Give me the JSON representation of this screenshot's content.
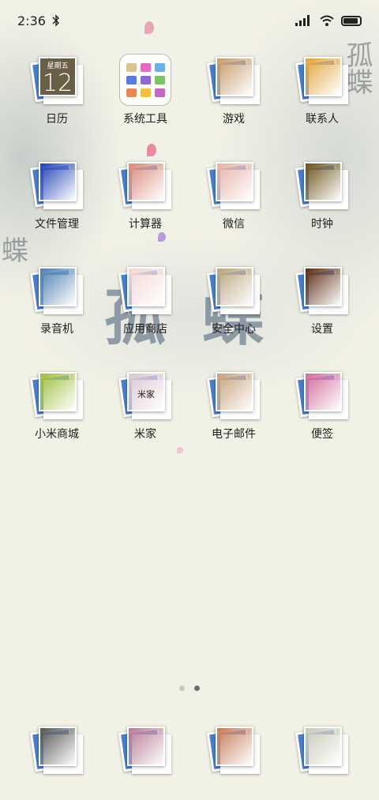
{
  "status_bar": {
    "time": "2:36",
    "battery_level": 0.9
  },
  "wallpaper": {
    "title": "孤蝶",
    "corner_text": "孤蝶",
    "left_text": "蝶"
  },
  "calendar": {
    "weekday": "星期五",
    "day": "12"
  },
  "apps": [
    {
      "label": "日历",
      "icon": "calendar-icon",
      "color": "#6b5e46"
    },
    {
      "label": "系统工具",
      "icon": "folder-icon",
      "color": "#ffffff"
    },
    {
      "label": "游戏",
      "icon": "game-icon",
      "color": "#c69a6a"
    },
    {
      "label": "联系人",
      "icon": "contacts-icon",
      "color": "#e4a43a"
    },
    {
      "label": "文件管理",
      "icon": "file-manager-icon",
      "color": "#2341b8"
    },
    {
      "label": "计算器",
      "icon": "calculator-icon",
      "color": "#d98a7a"
    },
    {
      "label": "微信",
      "icon": "wechat-icon",
      "color": "#e7b2a6"
    },
    {
      "label": "时钟",
      "icon": "clock-icon",
      "color": "#6d5218"
    },
    {
      "label": "录音机",
      "icon": "recorder-icon",
      "color": "#4d7fb0"
    },
    {
      "label": "应用商店",
      "icon": "app-store-icon",
      "color": "#f3d8d4"
    },
    {
      "label": "安全中心",
      "icon": "security-icon",
      "color": "#b9a57f"
    },
    {
      "label": "设置",
      "icon": "settings-icon",
      "color": "#5a2a10"
    },
    {
      "label": "小米商城",
      "icon": "mi-store-icon",
      "color": "#9fbf3a"
    },
    {
      "label": "米家",
      "icon": "mijia-icon",
      "color": "#dcc6d2",
      "front_text": "米家"
    },
    {
      "label": "电子邮件",
      "icon": "email-icon",
      "color": "#c8a07a"
    },
    {
      "label": "便签",
      "icon": "notes-icon",
      "color": "#d46a9a"
    }
  ],
  "folder_colors": [
    "#d9c38f",
    "#e36cbe",
    "#6ab0e0",
    "#5a7bd6",
    "#8c6ad0",
    "#7fc06a",
    "#e38a5a",
    "#f2c040",
    "#c06ac0"
  ],
  "dock": [
    {
      "icon": "phone-icon",
      "color": "#555555"
    },
    {
      "icon": "messages-icon",
      "color": "#b67b96"
    },
    {
      "icon": "browser-icon",
      "color": "#c67b5a"
    },
    {
      "icon": "camera-icon",
      "color": "#c9c9b8"
    }
  ],
  "page_indicator": {
    "total": 2,
    "current": 2
  }
}
